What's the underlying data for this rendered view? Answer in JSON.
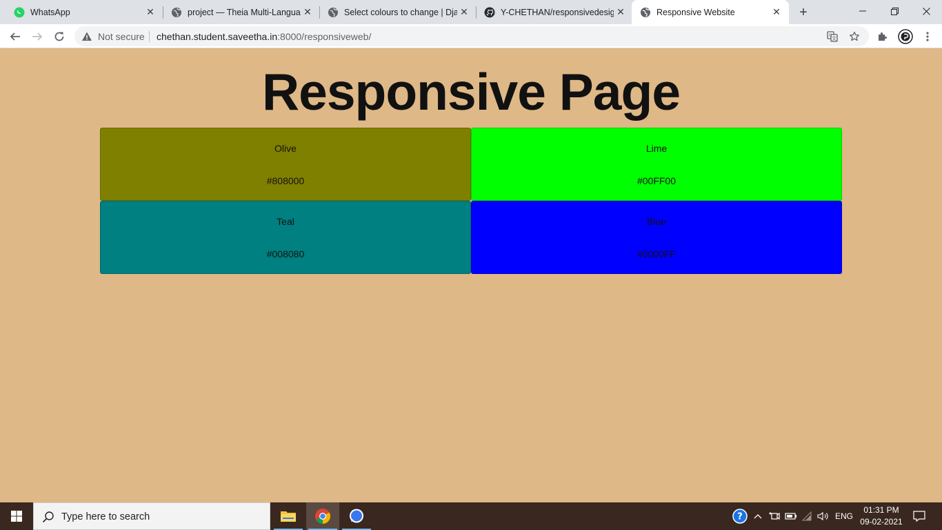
{
  "browser": {
    "tabs": [
      {
        "title": "WhatsApp",
        "icon": "whatsapp-icon",
        "active": false
      },
      {
        "title": "project — Theia Multi-Languag",
        "icon": "globe-icon",
        "active": false
      },
      {
        "title": "Select colours to change | Djan",
        "icon": "globe-icon",
        "active": false
      },
      {
        "title": "Y-CHETHAN/responsivedesign",
        "icon": "github-icon",
        "active": false
      },
      {
        "title": "Responsive Website",
        "icon": "globe-icon",
        "active": true
      }
    ],
    "address": {
      "security_label": "Not secure",
      "host": "chethan.student.saveetha.in",
      "rest": ":8000/responsiveweb/"
    }
  },
  "page": {
    "heading": "Responsive Page",
    "background": "#deb887",
    "colors": [
      {
        "name": "Olive",
        "hex": "#808000"
      },
      {
        "name": "Lime",
        "hex": "#00FF00"
      },
      {
        "name": "Teal",
        "hex": "#008080"
      },
      {
        "name": "Blue",
        "hex": "#0000FF"
      }
    ]
  },
  "taskbar": {
    "search_placeholder": "Type here to search",
    "language": "ENG",
    "time": "01:31 PM",
    "date": "09-02-2021"
  }
}
